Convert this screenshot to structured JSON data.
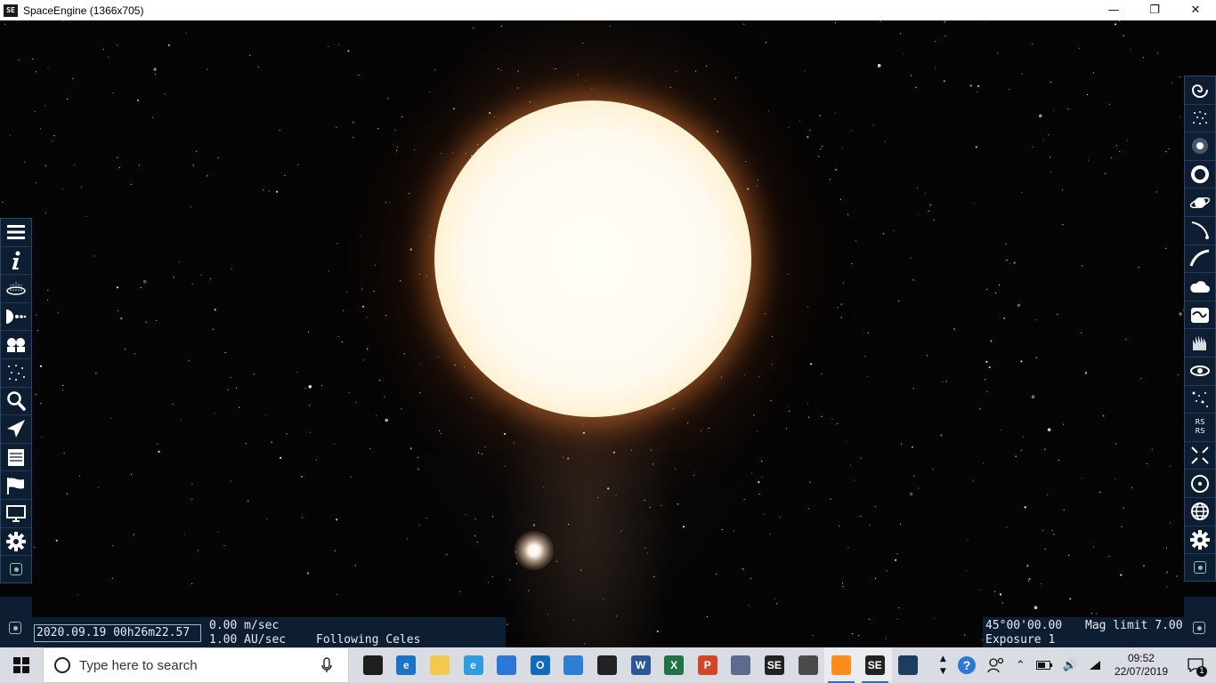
{
  "window": {
    "title": "SpaceEngine (1366x705)",
    "app_icon_label": "SE",
    "controls": [
      "minimize-icon",
      "maximize-icon",
      "close-icon"
    ]
  },
  "left_toolbar": {
    "icons": [
      "menu-icon",
      "info-icon",
      "planetarium-icon",
      "solar-system-icon",
      "star-browser-icon",
      "star-field-icon",
      "search-icon",
      "ship-icon",
      "journal-icon",
      "flag-icon",
      "display-icon",
      "gear-icon",
      "camera-icon"
    ]
  },
  "right_toolbar": {
    "icons": [
      "galaxy-icon",
      "star-cluster-icon",
      "nebula-icon",
      "ring-nebula-icon",
      "planet-icon",
      "comet-icon",
      "orbit-icon",
      "cloud-icon",
      "wave-icon",
      "nebula-hand-icon",
      "eye-icon",
      "stars-icon",
      "rs-icon",
      "expand-icon",
      "target-icon",
      "globe-icon",
      "gear-icon",
      "camera-icon"
    ],
    "rs_label": "RS"
  },
  "status": {
    "datetime": "2020.09.19  00h26m22.57",
    "speed": "0.00  m/sec",
    "speed2": "1.00  AU/sec",
    "following": "Following  Celes",
    "fov": "45°00'00.00",
    "exposure": "Exposure  1",
    "mag_limit": "Mag limit  7.00"
  },
  "taskbar": {
    "search_placeholder": "Type here to search",
    "apps": [
      {
        "name": "task-view",
        "label": "",
        "color": "#1f1f1f"
      },
      {
        "name": "edge",
        "label": "e",
        "color": "#1a73c8"
      },
      {
        "name": "file-explorer",
        "label": "",
        "color": "#f2c94c"
      },
      {
        "name": "internet-explorer",
        "label": "e",
        "color": "#2a9ee0"
      },
      {
        "name": "store",
        "label": "",
        "color": "#2b78d8"
      },
      {
        "name": "outlook",
        "label": "O",
        "color": "#0f6cbd"
      },
      {
        "name": "visual-studio",
        "label": "",
        "color": "#2d7fd3"
      },
      {
        "name": "mail",
        "label": "",
        "color": "#222"
      },
      {
        "name": "word",
        "label": "W",
        "color": "#2b579a"
      },
      {
        "name": "excel",
        "label": "X",
        "color": "#217346"
      },
      {
        "name": "powerpoint",
        "label": "P",
        "color": "#d24726"
      },
      {
        "name": "celestia",
        "label": "",
        "color": "#5b6c8f"
      },
      {
        "name": "spaceengine-alt",
        "label": "SE",
        "color": "#222"
      },
      {
        "name": "game",
        "label": "",
        "color": "#4a4a4a"
      },
      {
        "name": "discord",
        "label": "",
        "color": "#ff8c1a"
      },
      {
        "name": "spaceengine",
        "label": "SE",
        "color": "#222"
      },
      {
        "name": "steam",
        "label": "",
        "color": "#1b3d5f"
      }
    ],
    "clock_time": "09:52",
    "clock_date": "22/07/2019",
    "notifications": "1"
  }
}
